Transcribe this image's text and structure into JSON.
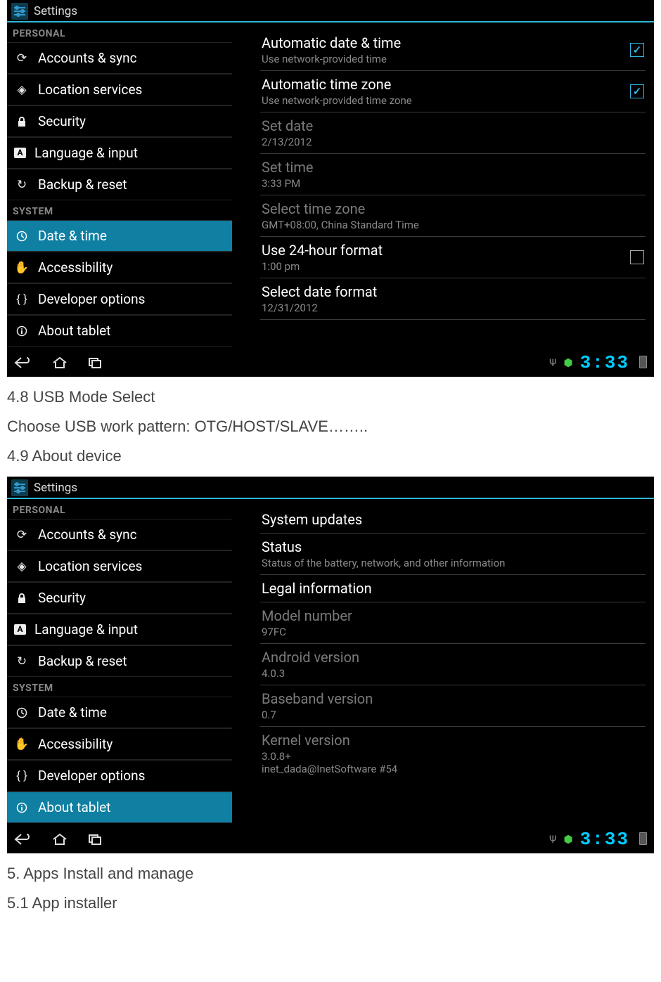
{
  "doc": {
    "sec_4_8_title": "4.8 USB Mode Select",
    "sec_4_8_body": "Choose USB work pattern: OTG/HOST/SLAVE……..",
    "sec_4_9_title": "4.9 About device",
    "sec_5_title": "5. Apps Install and manage",
    "sec_5_1_title": "5.1 App installer"
  },
  "shot1": {
    "app_name": "Settings",
    "section_personal": "PERSONAL",
    "section_system": "SYSTEM",
    "side": {
      "accounts": "Accounts & sync",
      "location": "Location services",
      "security": "Security",
      "language": "Language & input",
      "backup": "Backup & reset",
      "datetime": "Date & time",
      "access": "Accessibility",
      "developer": "Developer options",
      "about": "About tablet"
    },
    "rows": {
      "auto_dt": {
        "title": "Automatic date & time",
        "sub": "Use network-provided time",
        "checked": true
      },
      "auto_tz": {
        "title": "Automatic time zone",
        "sub": "Use network-provided time zone",
        "checked": true
      },
      "set_date": {
        "title": "Set date",
        "sub": "2/13/2012"
      },
      "set_time": {
        "title": "Set time",
        "sub": "3:33 PM"
      },
      "select_tz": {
        "title": "Select time zone",
        "sub": "GMT+08:00, China Standard Time"
      },
      "use_24h": {
        "title": "Use 24-hour format",
        "sub": "1:00 pm",
        "checked": false
      },
      "date_fmt": {
        "title": "Select date format",
        "sub": "12/31/2012"
      }
    },
    "clock": "3:33"
  },
  "shot2": {
    "app_name": "Settings",
    "section_personal": "PERSONAL",
    "section_system": "SYSTEM",
    "side": {
      "accounts": "Accounts & sync",
      "location": "Location services",
      "security": "Security",
      "language": "Language & input",
      "backup": "Backup & reset",
      "datetime": "Date & time",
      "access": "Accessibility",
      "developer": "Developer options",
      "about": "About tablet"
    },
    "rows": {
      "updates": {
        "title": "System updates"
      },
      "status": {
        "title": "Status",
        "sub": "Status of the battery, network, and other information"
      },
      "legal": {
        "title": "Legal information"
      },
      "model": {
        "title": "Model number",
        "sub": "97FC"
      },
      "android": {
        "title": "Android version",
        "sub": "4.0.3"
      },
      "baseband": {
        "title": "Baseband version",
        "sub": "0.7"
      },
      "kernel": {
        "title": "Kernel version",
        "sub": "3.0.8+\ninet_dada@InetSoftware #54"
      }
    },
    "clock": "3:33"
  }
}
